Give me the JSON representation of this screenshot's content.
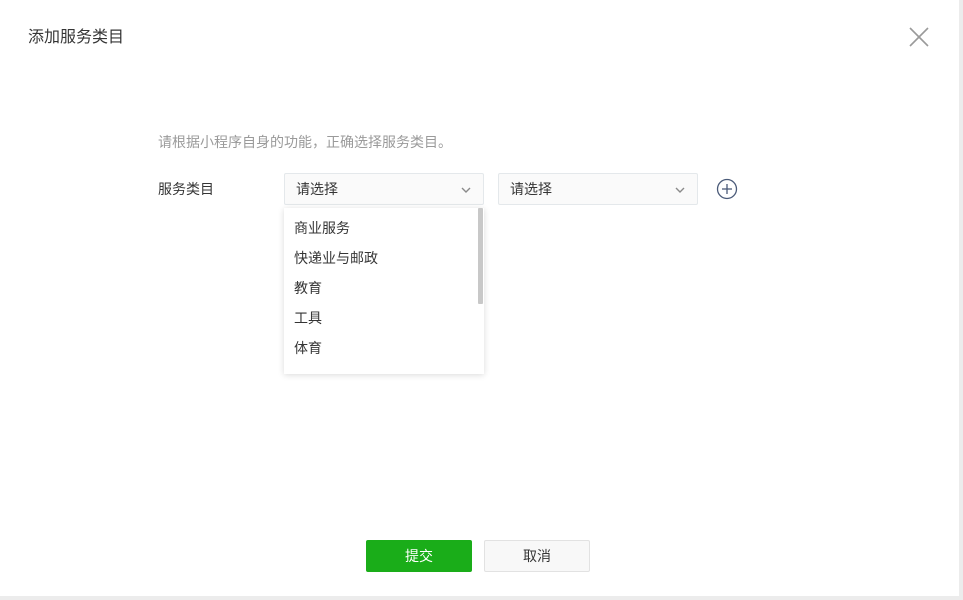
{
  "dialog": {
    "title": "添加服务类目",
    "close_icon": "close-icon"
  },
  "form": {
    "hint": "请根据小程序自身的功能，正确选择服务类目。",
    "label": "服务类目",
    "select_primary": {
      "value": "请选择",
      "icon": "chevron-down-icon"
    },
    "select_secondary": {
      "value": "请选择",
      "icon": "chevron-down-icon"
    },
    "add_icon": "plus-circle-icon"
  },
  "dropdown": {
    "items": [
      "商业服务",
      "快递业与邮政",
      "教育",
      "工具",
      "体育"
    ]
  },
  "footer": {
    "submit_label": "提交",
    "cancel_label": "取消"
  },
  "colors": {
    "primary": "#1aad19",
    "hint_text": "#9a9a9a",
    "text": "#353535"
  }
}
